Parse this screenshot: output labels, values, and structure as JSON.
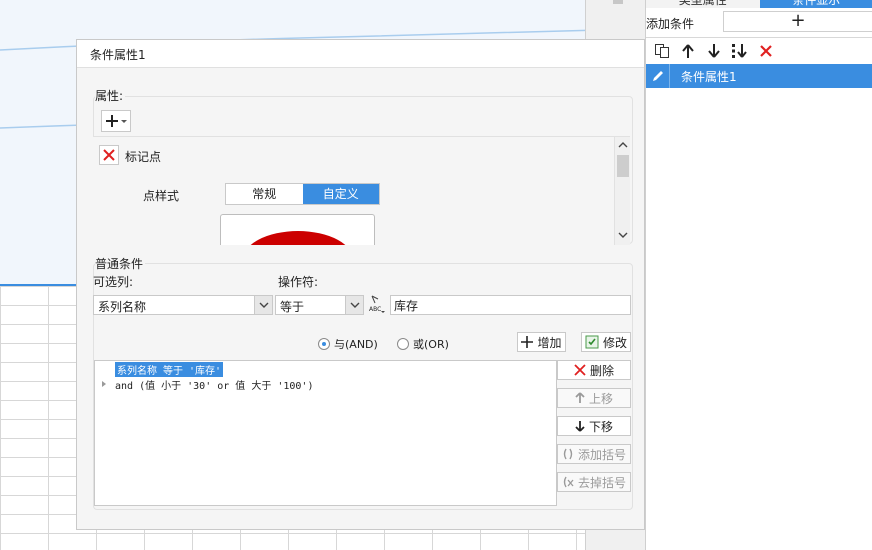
{
  "right_panel": {
    "tabs": [
      "类型属性",
      "条件显示"
    ],
    "add_condition_label": "添加条件",
    "add_button_glyph": "+",
    "toolbar_icons": [
      "copy-icon",
      "arrow-up-icon",
      "arrow-down-icon",
      "move-to-bottom-icon",
      "delete-x-icon"
    ],
    "items": [
      {
        "label": "条件属性1",
        "icon": "edit-pencil-icon",
        "selected": true
      }
    ]
  },
  "dialog": {
    "title": "条件属性1",
    "properties": {
      "group_label": "属性:",
      "plus_glyph": "+",
      "marker_label": "标记点",
      "point_style_label": "点样式",
      "point_style_options": [
        "常规",
        "自定义"
      ],
      "point_style_selected": "自定义"
    },
    "condition": {
      "group_label": "普通条件",
      "column_label": "可选列:",
      "operator_label": "操作符:",
      "column_value": "系列名称",
      "operator_value": "等于",
      "value_text": "库存",
      "radio_and": "与(AND)",
      "radio_or": "或(OR)",
      "logic_selected": "and",
      "add_button": "增加",
      "modify_button": "修改",
      "list_rows": [
        "系列名称 等于 '库存'",
        "and (值 小于 '30' or 值 大于 '100')"
      ],
      "side_buttons": {
        "delete": "删除",
        "move_up": "上移",
        "move_down": "下移",
        "add_bracket": "添加括号",
        "remove_bracket": "去掉括号"
      }
    }
  },
  "colors": {
    "accent": "#3a8de0",
    "delete_red": "#e02020",
    "marker_red": "#cc0000"
  }
}
